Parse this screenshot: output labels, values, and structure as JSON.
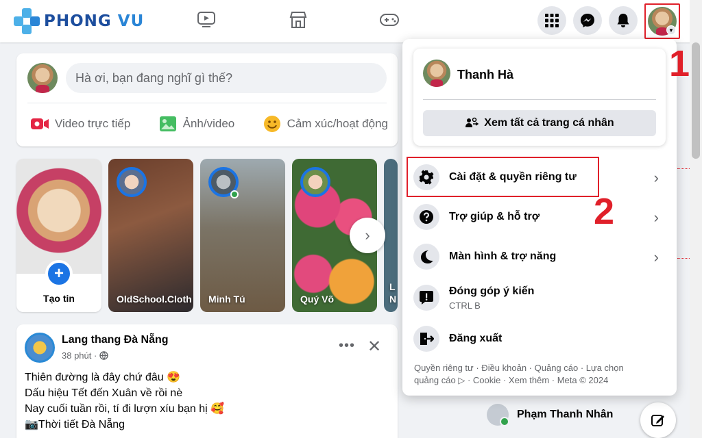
{
  "brand": {
    "name_part1": "PHONG ",
    "name_part2": "VU"
  },
  "topnav": {
    "icons": [
      "video-icon",
      "marketplace-icon",
      "gaming-icon"
    ],
    "menu_button": "grid-menu-icon",
    "messenger": "messenger-icon",
    "notifications": "bell-icon",
    "profile": "profile-avatar"
  },
  "composer": {
    "placeholder": "Hà ơi, bạn đang nghĩ gì thế?",
    "actions": [
      {
        "label": "Video trực tiếp",
        "icon": "live-video-icon",
        "color": "#e42645"
      },
      {
        "label": "Ảnh/video",
        "icon": "photo-icon",
        "color": "#45bd62"
      },
      {
        "label": "Cảm xúc/hoạt động",
        "icon": "feeling-icon",
        "color": "#f7b928"
      }
    ]
  },
  "stories": {
    "create_label": "Tạo tin",
    "items": [
      {
        "name": "OldSchool.Cloth"
      },
      {
        "name": "Minh Tú"
      },
      {
        "name": "Quý Võ"
      },
      {
        "name": "L N"
      }
    ]
  },
  "post": {
    "author": "Lang thang Đà Nẵng",
    "time": "38 phút ·",
    "lines": [
      "Thiên đường là đây chứ đâu 😍",
      "Dấu hiệu Tết đến Xuân về rồi nè",
      "Nay cuối tuần rồi, tí đi lượn xíu bạn hị 🥰",
      "📷Thời tiết Đà Nẵng"
    ]
  },
  "contacts": [
    {
      "name": "Phạm Thanh Nhân"
    }
  ],
  "menu": {
    "profile_name": "Thanh Hà",
    "see_all_label": "Xem tất cả trang cá nhân",
    "items": [
      {
        "label": "Cài đặt & quyền riêng tư",
        "icon": "gear-icon"
      },
      {
        "label": "Trợ giúp & hỗ trợ",
        "icon": "help-icon"
      },
      {
        "label": "Màn hình & trợ năng",
        "icon": "moon-icon"
      },
      {
        "label": "Đóng góp ý kiến",
        "sub": "CTRL B",
        "icon": "feedback-icon"
      },
      {
        "label": "Đăng xuất",
        "icon": "logout-icon"
      }
    ],
    "footer_line1": "Quyền riêng tư · Điều khoản · Quảng cáo · Lựa chọn",
    "footer_line2": "quảng cáo ▷ · Cookie · Xem thêm · Meta © 2024"
  },
  "annotations": {
    "step1": "1",
    "step2": "2"
  },
  "colors": {
    "accent": "#1b74e4",
    "annotation": "#e0202a",
    "brand": "#1d4e9e"
  }
}
